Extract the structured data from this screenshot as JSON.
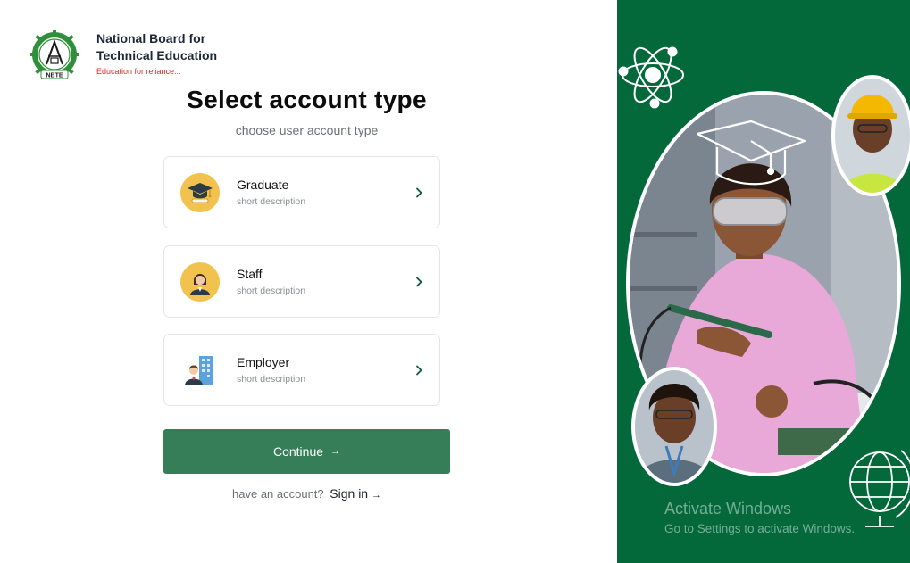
{
  "brand": {
    "name_line1": "National Board for",
    "name_line2": "Technical Education",
    "tagline": "Education for reliance...",
    "logo_text": "NBTE"
  },
  "page": {
    "title": "Select account type",
    "subtitle": "choose user account type"
  },
  "account_types": [
    {
      "label": "Graduate",
      "description": "short description",
      "icon": "graduation-cap-icon"
    },
    {
      "label": "Staff",
      "description": "short description",
      "icon": "staff-avatar-icon"
    },
    {
      "label": "Employer",
      "description": "short description",
      "icon": "employer-building-icon"
    }
  ],
  "actions": {
    "continue_label": "Continue",
    "continue_arrow": "→",
    "have_account_text": "have an account?",
    "signin_label": "Sign in",
    "signin_arrow": "→"
  },
  "watermark": {
    "title": "Activate Windows",
    "subtitle": "Go to Settings to activate Windows."
  },
  "colors": {
    "brand_green": "#04693a",
    "button_green": "#357e58",
    "badge_yellow": "#f2c24e",
    "tagline_red": "#e22b2b"
  }
}
